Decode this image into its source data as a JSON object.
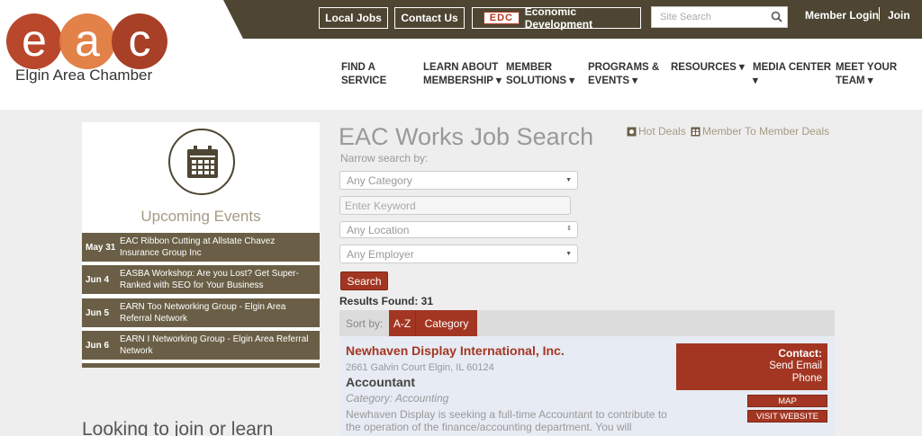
{
  "brand": {
    "name": "Elgin Area Chamber",
    "logo_letters": "eac"
  },
  "topbar": {
    "local_jobs": "Local Jobs",
    "contact_us": "Contact Us",
    "edc_logo": "EDC",
    "economic_development": "Economic Development",
    "search_placeholder": "Site Search",
    "member_login": "Member Login",
    "join": "Join"
  },
  "nav": [
    {
      "line1": "FIND A",
      "line2": "SERVICE"
    },
    {
      "line1": "LEARN ABOUT",
      "line2": "MEMBERSHIP ▾"
    },
    {
      "line1": "MEMBER",
      "line2": "SOLUTIONS ▾"
    },
    {
      "line1": "PROGRAMS &",
      "line2": "EVENTS ▾"
    },
    {
      "line1": "RESOURCES ▾",
      "line2": ""
    },
    {
      "line1": "MEDIA CENTER",
      "line2": "▾"
    },
    {
      "line1": "MEET YOUR",
      "line2": "TEAM ▾"
    }
  ],
  "events": {
    "title": "Upcoming Events",
    "items": [
      {
        "date": "May 31",
        "text": "EAC Ribbon Cutting at Allstate Chavez Insurance Group Inc"
      },
      {
        "date": "Jun 4",
        "text": "EASBA Workshop: Are you Lost? Get Super-Ranked with SEO for Your Business"
      },
      {
        "date": "Jun 5",
        "text": "EARN Too Networking Group - Elgin Area Referral Network"
      },
      {
        "date": "Jun 6",
        "text": "EARN I Networking Group - Elgin Area Referral Network"
      }
    ]
  },
  "join_heading": "Looking to join or learn",
  "main": {
    "title": "EAC Works Job Search",
    "hot_deals": "Hot Deals",
    "member_deals": "Member To Member Deals",
    "narrow_label": "Narrow search by:",
    "category_select": "Any Category",
    "keyword_placeholder": "Enter Keyword",
    "location_select": "Any Location",
    "employer_select": "Any Employer",
    "search_button": "Search",
    "results_found": "Results Found: 31",
    "sort_label": "Sort by:",
    "sort_az": "A-Z",
    "sort_category": "Category"
  },
  "listing": {
    "business": "Newhaven Display International, Inc.",
    "address": "2661 Galvin Court Elgin, IL 60124",
    "job_title": "Accountant",
    "category": "Category: Accounting",
    "description": "Newhaven Display is seeking a full-time Accountant to contribute to the operation of the finance/accounting department. You will",
    "contact_heading": "Contact:",
    "send_email": "Send Email",
    "phone": "Phone",
    "map": "MAP",
    "visit_website": "VISIT WEBSITE"
  },
  "colors": {
    "brand_brown": "#4e4633",
    "accent_red": "#a33622",
    "event_row": "#6a5f46",
    "logo_orange": "#e2622f"
  }
}
